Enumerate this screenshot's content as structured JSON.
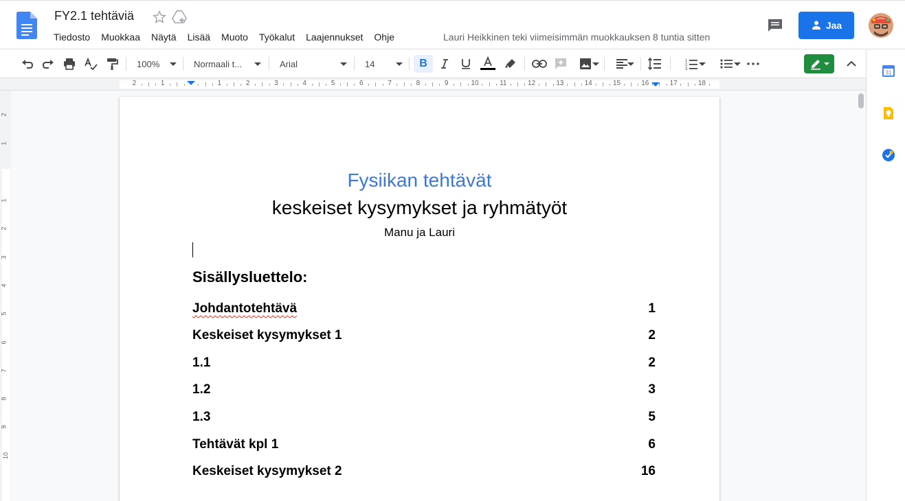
{
  "header": {
    "doc_title": "FY2.1 tehtäviä",
    "menu": [
      "Tiedosto",
      "Muokkaa",
      "Näytä",
      "Lisää",
      "Muoto",
      "Työkalut",
      "Laajennukset",
      "Ohje"
    ],
    "last_edit": "Lauri Heikkinen teki viimeisimmän muokkauksen 8 tuntia sitten",
    "share_label": "Jaa"
  },
  "toolbar": {
    "zoom": "100%",
    "style": "Normaali t...",
    "font": "Arial",
    "font_size": "14",
    "bold_label": "B"
  },
  "ruler": {
    "labels": [
      "2",
      "1",
      "1",
      "2",
      "3",
      "4",
      "5",
      "6",
      "7",
      "8",
      "9",
      "10",
      "11",
      "12",
      "13",
      "14",
      "15",
      "16",
      "17",
      "18"
    ],
    "vertical_labels": [
      "2",
      "1",
      "1",
      "2",
      "3",
      "4",
      "5",
      "6",
      "7",
      "8",
      "9",
      "10"
    ]
  },
  "side_panel": {
    "calendar_day": "31"
  },
  "document": {
    "title": "Fysiikan tehtävät",
    "subtitle": "keskeiset kysymykset ja ryhmätyöt",
    "authors": "Manu ja Lauri",
    "toc_heading": "Sisällysluettelo:",
    "toc": [
      {
        "label": "Johdantotehtävä",
        "page": "1"
      },
      {
        "label": "Keskeiset kysymykset 1",
        "page": "2"
      },
      {
        "label": "1.1",
        "page": "2"
      },
      {
        "label": "1.2",
        "page": "3"
      },
      {
        "label": "1.3",
        "page": "5"
      },
      {
        "label": "Tehtävät kpl 1",
        "page": "6"
      },
      {
        "label": "Keskeiset kysymykset 2",
        "page": "16"
      }
    ]
  },
  "colors": {
    "accent": "#1a73e8",
    "title_blue": "#3c78d8",
    "edit_green": "#1e8e3e"
  }
}
